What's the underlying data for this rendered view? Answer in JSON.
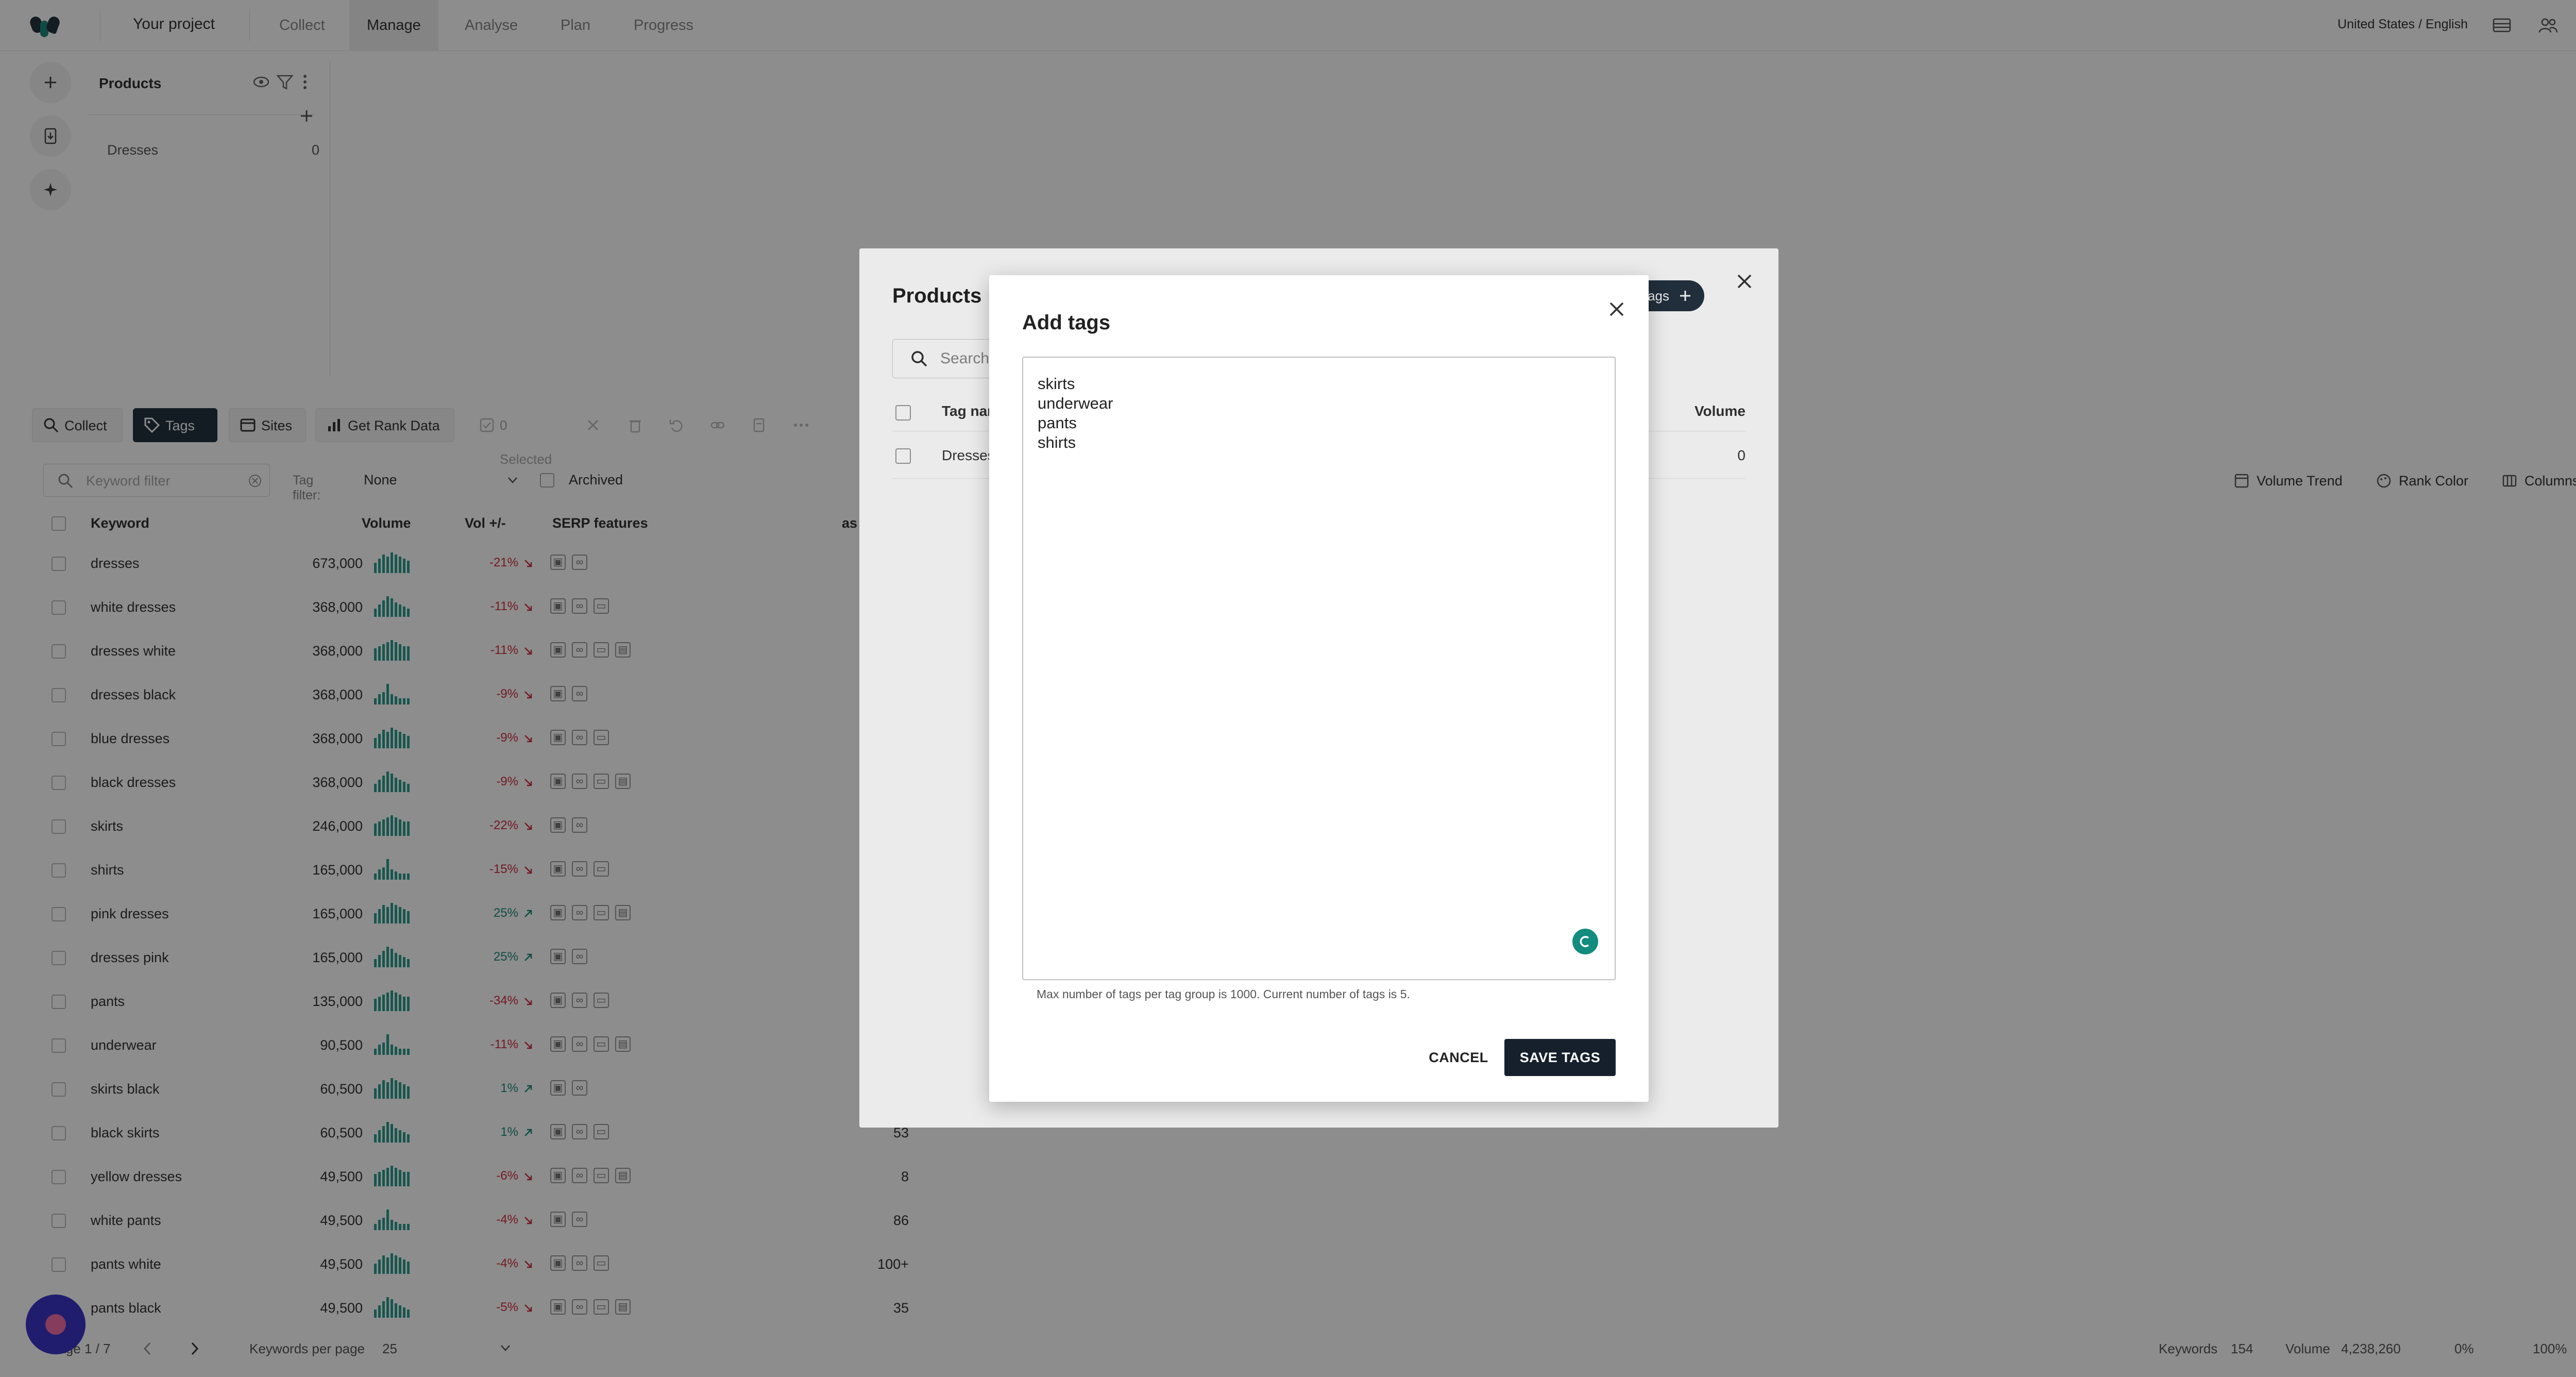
{
  "topbar": {
    "project": "Your project",
    "tabs": [
      {
        "label": "Collect"
      },
      {
        "label": "Manage"
      },
      {
        "label": "Analyse"
      },
      {
        "label": "Plan"
      },
      {
        "label": "Progress"
      }
    ],
    "locale": "United States / English"
  },
  "tree": {
    "title": "Products",
    "item": "Dresses",
    "count": "0"
  },
  "toolbar": {
    "collect": "Collect",
    "tags": "Tags",
    "sites": "Sites",
    "rank": "Get Rank Data",
    "selected": "0 Selected"
  },
  "filters": {
    "keyword_placeholder": "Keyword filter",
    "tag_filter_label": "Tag filter:",
    "tag_filter_value": "None",
    "archived": "Archived",
    "volume_trend": "Volume Trend",
    "rank_color": "Rank Color",
    "columns": "Columns"
  },
  "table": {
    "headers": {
      "keyword": "Keyword",
      "volume": "Volume",
      "vol_change": "Vol +/-",
      "serp": "SERP features",
      "ascore": "as"
    },
    "rows": [
      {
        "keyword": "dresses",
        "volume": "673,000",
        "change": "-21%",
        "ascore": ""
      },
      {
        "keyword": "white dresses",
        "volume": "368,000",
        "change": "-11%",
        "ascore": ""
      },
      {
        "keyword": "dresses white",
        "volume": "368,000",
        "change": "-11%",
        "ascore": ""
      },
      {
        "keyword": "dresses black",
        "volume": "368,000",
        "change": "-9%",
        "ascore": ""
      },
      {
        "keyword": "blue dresses",
        "volume": "368,000",
        "change": "-9%",
        "ascore": ""
      },
      {
        "keyword": "black dresses",
        "volume": "368,000",
        "change": "-9%",
        "ascore": ""
      },
      {
        "keyword": "skirts",
        "volume": "246,000",
        "change": "-22%",
        "ascore": ""
      },
      {
        "keyword": "shirts",
        "volume": "165,000",
        "change": "-15%",
        "ascore": ""
      },
      {
        "keyword": "pink dresses",
        "volume": "165,000",
        "change": "25%",
        "ascore": ""
      },
      {
        "keyword": "dresses pink",
        "volume": "165,000",
        "change": "25%",
        "ascore": ""
      },
      {
        "keyword": "pants",
        "volume": "135,000",
        "change": "-34%",
        "ascore": ""
      },
      {
        "keyword": "underwear",
        "volume": "90,500",
        "change": "-11%",
        "ascore": ""
      },
      {
        "keyword": "skirts black",
        "volume": "60,500",
        "change": "1%",
        "ascore": ""
      },
      {
        "keyword": "black skirts",
        "volume": "60,500",
        "change": "1%",
        "ascore": "53"
      },
      {
        "keyword": "yellow dresses",
        "volume": "49,500",
        "change": "-6%",
        "ascore": "8"
      },
      {
        "keyword": "white pants",
        "volume": "49,500",
        "change": "-4%",
        "ascore": "86"
      },
      {
        "keyword": "pants white",
        "volume": "49,500",
        "change": "-4%",
        "ascore": "100+"
      },
      {
        "keyword": "pants black",
        "volume": "49,500",
        "change": "-5%",
        "ascore": "35"
      }
    ]
  },
  "footer": {
    "page": "Page 1 / 7",
    "per_page_label": "Keywords per page",
    "per_page": "25",
    "keywords_label": "Keywords",
    "keywords": "154",
    "volume_label": "Volume",
    "volume": "4,238,260",
    "pct1": "0%",
    "pct2": "100%"
  },
  "products_modal": {
    "title": "Products",
    "add_tags": "Tags",
    "search_placeholder": "Search",
    "header_tag": "Tag name",
    "header_volume": "Volume",
    "row_tag": "Dresses",
    "row_volume": "0"
  },
  "add_tags_modal": {
    "title": "Add tags",
    "text": "skirts\nunderwear\npants\nshirts",
    "hint": "Max number of tags per tag group is 1000. Current number of tags is 5.",
    "cancel": "CANCEL",
    "save": "SAVE TAGS"
  },
  "colors": {
    "dark": "#243240",
    "teal": "#1e8a7a",
    "negative": "#d03040"
  }
}
